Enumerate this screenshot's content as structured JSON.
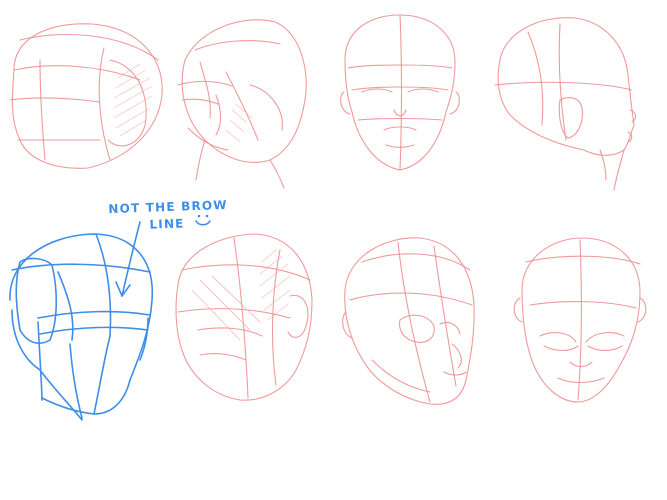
{
  "annotation": {
    "line1": "NOT THE BROW",
    "line2": "LINE",
    "smiley": "smiley-face-icon"
  },
  "colors": {
    "sketch_red": "#ec8f8f",
    "sketch_blue": "#3f8ee6",
    "background": "#ffffff"
  }
}
